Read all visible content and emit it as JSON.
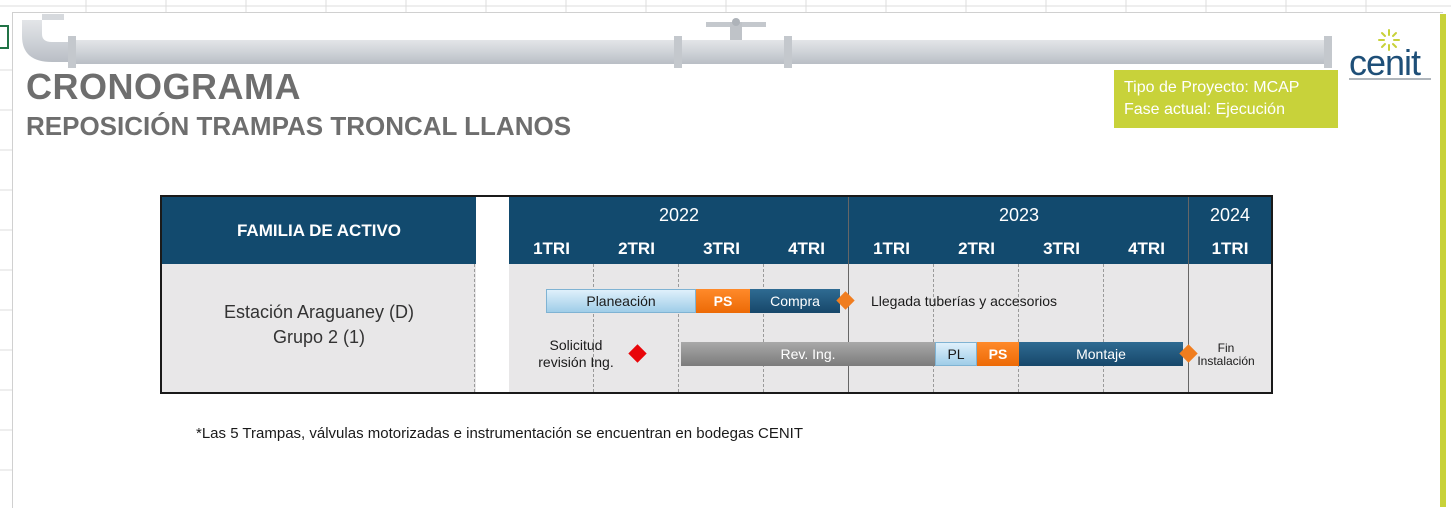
{
  "header": {
    "title": "CRONOGRAMA",
    "subtitle": "REPOSICIÓN TRAMPAS TRONCAL LLANOS",
    "info_line1": "Tipo de Proyecto: MCAP",
    "info_line2": "Fase actual: Ejecución",
    "logo_text": "cenit"
  },
  "colors": {
    "header_bg": "#124a6e",
    "accent": "#c8d23a",
    "orange": "#f07d1f",
    "milestone_red": "#e8060a"
  },
  "table": {
    "family_header": "FAMILIA DE ACTIVO",
    "years": [
      "2022",
      "2023",
      "2024"
    ],
    "quarters": [
      "1TRI",
      "2TRI",
      "3TRI",
      "4TRI",
      "1TRI",
      "2TRI",
      "3TRI",
      "4TRI",
      "1TRI"
    ],
    "row_label_line1": "Estación Araguaney (D)",
    "row_label_line2": "Grupo 2 (1)"
  },
  "gantt": {
    "planeacion": "Planeación",
    "ps1": "PS",
    "compra": "Compra",
    "llegada": "Llegada tuberías y accesorios",
    "solicitud_line1": "Solicitud",
    "solicitud_line2": "revisión Ing.",
    "rev_ing": "Rev. Ing.",
    "pl": "PL",
    "ps2": "PS",
    "montaje": "Montaje",
    "fin_line1": "Fin",
    "fin_line2": "Instalación"
  },
  "footnote": "*Las 5 Trampas, válvulas motorizadas e instrumentación se encuentran en bodegas CENIT"
}
